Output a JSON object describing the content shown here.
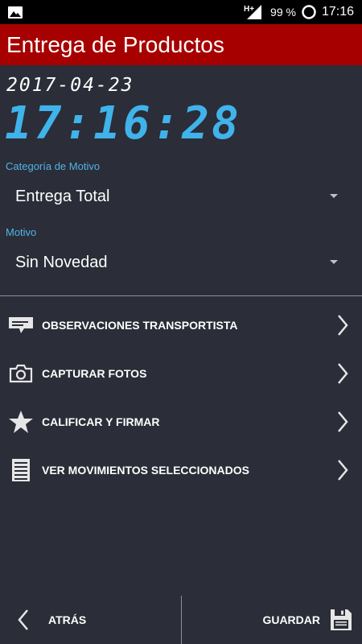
{
  "status_bar": {
    "network": "H+",
    "battery": "99 %",
    "time": "17:16"
  },
  "app_bar": {
    "title": "Entrega de Productos"
  },
  "datetime": {
    "date": "2017-04-23",
    "time": "17:16:28"
  },
  "categoria": {
    "label": "Categoría de Motivo",
    "value": "Entrega Total"
  },
  "motivo": {
    "label": "Motivo",
    "value": "Sin Novedad"
  },
  "menu": [
    {
      "label": "OBSERVACIONES TRANSPORTISTA",
      "icon": "message-icon"
    },
    {
      "label": "CAPTURAR FOTOS",
      "icon": "camera-icon"
    },
    {
      "label": "CALIFICAR Y FIRMAR",
      "icon": "star-icon"
    },
    {
      "label": "VER MOVIMIENTOS SELECCIONADOS",
      "icon": "list-icon"
    }
  ],
  "bottom": {
    "back_label": "ATRÁS",
    "save_label": "GUARDAR"
  },
  "colors": {
    "app_bar": "#a70000",
    "background": "#2b2d38",
    "accent": "#3fb3ea"
  }
}
